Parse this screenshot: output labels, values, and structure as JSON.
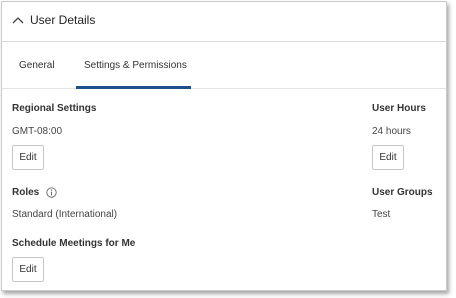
{
  "header": {
    "title": "User Details",
    "chevron_icon": "chevron-up-icon"
  },
  "tabs": [
    {
      "label": "General",
      "active": false
    },
    {
      "label": "Settings & Permissions",
      "active": true
    }
  ],
  "colors": {
    "tab_underline": "#1f4e8c",
    "border": "#c9c9c9"
  },
  "regional_settings": {
    "label": "Regional Settings",
    "value": "GMT-08:00",
    "edit_label": "Edit"
  },
  "user_hours": {
    "label": "User Hours",
    "value": "24 hours",
    "edit_label": "Edit"
  },
  "roles": {
    "label": "Roles",
    "info_icon": "info-icon",
    "value": "Standard (International)"
  },
  "user_groups": {
    "label": "User Groups",
    "value": "Test"
  },
  "schedule_meetings": {
    "label": "Schedule Meetings for Me",
    "edit_label": "Edit"
  }
}
